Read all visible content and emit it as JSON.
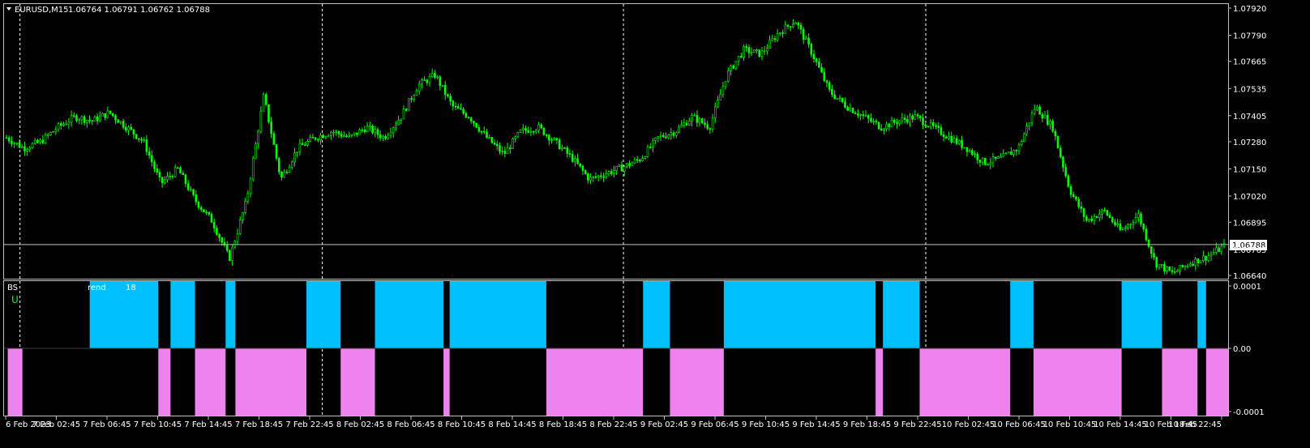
{
  "chart_header": {
    "symbol_tf": "EURUSD,M15",
    "ohlc": "1.06764 1.06791 1.06762 1.06788",
    "menu_icon": "triangle-down-icon"
  },
  "indicator_header": {
    "name_start": "BS",
    "name_middle": "rend",
    "name_end": "18",
    "mark": "U"
  },
  "current_price_label": "1.06788",
  "colors": {
    "background": "#000000",
    "candle": "#00ff00",
    "grid": "#ffffff",
    "bull_histogram": "#00bfff",
    "bear_histogram": "#ee82ee",
    "price_line": "#c0c0c0"
  },
  "chart_data": {
    "type": "candlestick",
    "symbol": "EURUSD",
    "timeframe": "M15",
    "last": 1.06788,
    "y_ticks": [
      "1.07920",
      "1.07790",
      "1.07665",
      "1.07535",
      "1.07405",
      "1.07280",
      "1.07150",
      "1.07020",
      "1.06895",
      "1.06765",
      "1.06640"
    ],
    "ylim": [
      1.0664,
      1.0792
    ],
    "x_ticks": [
      "6 Feb 2023",
      "7 Feb 02:45",
      "7 Feb 06:45",
      "7 Feb 10:45",
      "7 Feb 14:45",
      "7 Feb 18:45",
      "7 Feb 22:45",
      "8 Feb 02:45",
      "8 Feb 06:45",
      "8 Feb 10:45",
      "8 Feb 14:45",
      "8 Feb 18:45",
      "8 Feb 22:45",
      "9 Feb 02:45",
      "9 Feb 06:45",
      "9 Feb 10:45",
      "9 Feb 14:45",
      "9 Feb 18:45",
      "9 Feb 22:45",
      "10 Feb 02:45",
      "10 Feb 06:45",
      "10 Feb 10:45",
      "10 Feb 14:45",
      "10 Feb 18:45",
      "10 Feb 22:45"
    ],
    "trend": [
      1.073,
      1.0725,
      1.0728,
      1.0735,
      1.074,
      1.0738,
      1.0742,
      1.0735,
      1.0728,
      1.0708,
      1.0715,
      1.07,
      1.069,
      1.0672,
      1.07,
      1.075,
      1.071,
      1.0725,
      1.073,
      1.0733,
      1.073,
      1.0735,
      1.073,
      1.074,
      1.0755,
      1.076,
      1.0745,
      1.074,
      1.073,
      1.0722,
      1.0733,
      1.0735,
      1.0728,
      1.072,
      1.071,
      1.0713,
      1.0716,
      1.072,
      1.073,
      1.0733,
      1.074,
      1.0735,
      1.076,
      1.0772,
      1.077,
      1.078,
      1.0786,
      1.077,
      1.0752,
      1.0745,
      1.074,
      1.0735,
      1.0738,
      1.074,
      1.0735,
      1.073,
      1.0725,
      1.0718,
      1.072,
      1.0725,
      1.0745,
      1.0735,
      1.0705,
      1.069,
      1.0695,
      1.0685,
      1.0693,
      1.067,
      1.0665,
      1.067,
      1.0673,
      1.0678
    ],
    "bull_segments": [
      [
        0.07,
        0.126
      ],
      [
        0.136,
        0.156
      ],
      [
        0.181,
        0.189
      ],
      [
        0.247,
        0.275
      ],
      [
        0.303,
        0.359
      ],
      [
        0.364,
        0.443
      ],
      [
        0.522,
        0.544
      ],
      [
        0.588,
        0.712
      ],
      [
        0.718,
        0.748
      ],
      [
        0.822,
        0.841
      ],
      [
        0.913,
        0.946
      ],
      [
        0.975,
        0.982
      ],
      [
        1.021,
        1.052
      ]
    ],
    "bear_segments": [
      [
        0.003,
        0.015
      ],
      [
        0.126,
        0.136
      ],
      [
        0.156,
        0.181
      ],
      [
        0.189,
        0.247
      ],
      [
        0.275,
        0.303
      ],
      [
        0.359,
        0.364
      ],
      [
        0.443,
        0.522
      ],
      [
        0.544,
        0.588
      ],
      [
        0.712,
        0.718
      ],
      [
        0.748,
        0.822
      ],
      [
        0.841,
        0.913
      ],
      [
        0.946,
        0.975
      ],
      [
        0.982,
        1.021
      ]
    ],
    "indicator_y_ticks": [
      "0.0001",
      "0.00",
      "-0.0001"
    ],
    "indicator_ylim": [
      -0.0001,
      0.0001
    ]
  }
}
